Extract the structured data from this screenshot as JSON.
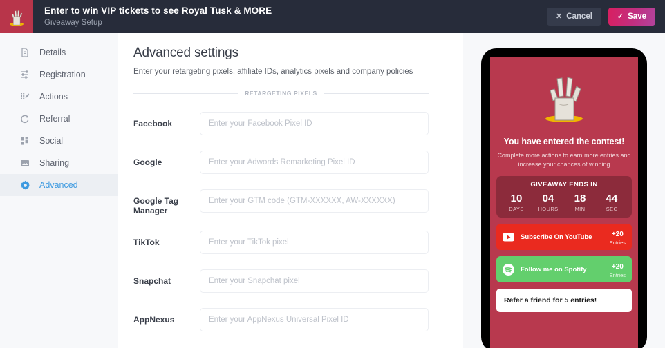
{
  "topbar": {
    "title": "Enter to win VIP tickets to see Royal Tusk & MORE",
    "subtitle": "Giveaway Setup",
    "cancel_label": "Cancel",
    "cancel_icon": "close-x-icon",
    "save_label": "Save",
    "save_icon": "check-icon",
    "logo_icon": "zombie-hand-logo",
    "bg_color": "#272c3a",
    "save_gradient_from": "#d81f60",
    "save_gradient_to": "#b3439c"
  },
  "sidebar": {
    "items": [
      {
        "label": "Details",
        "icon": "document-icon",
        "active": false
      },
      {
        "label": "Registration",
        "icon": "sliders-icon",
        "active": false
      },
      {
        "label": "Actions",
        "icon": "tasks-pen-icon",
        "active": false
      },
      {
        "label": "Referral",
        "icon": "refresh-icon",
        "active": false
      },
      {
        "label": "Social",
        "icon": "grid-icon",
        "active": false
      },
      {
        "label": "Sharing",
        "icon": "image-icon",
        "active": false
      },
      {
        "label": "Advanced",
        "icon": "gear-icon",
        "active": true
      }
    ],
    "active_color": "#3d9ae0"
  },
  "main": {
    "title": "Advanced settings",
    "subtitle": "Enter your retargeting pixels, affiliate IDs, analytics pixels and company policies",
    "section_label": "RETARGETING PIXELS",
    "fields": [
      {
        "label": "Facebook",
        "placeholder": "Enter your Facebook Pixel ID",
        "value": ""
      },
      {
        "label": "Google",
        "placeholder": "Enter your Adwords Remarketing Pixel ID",
        "value": ""
      },
      {
        "label": "Google Tag Manager",
        "placeholder": "Enter your GTM code (GTM-XXXXXX, AW-XXXXXX)",
        "value": ""
      },
      {
        "label": "TikTok",
        "placeholder": "Enter your TikTok pixel",
        "value": ""
      },
      {
        "label": "Snapchat",
        "placeholder": "Enter your Snapchat pixel",
        "value": ""
      },
      {
        "label": "AppNexus",
        "placeholder": "Enter your AppNexus Universal Pixel ID",
        "value": ""
      }
    ]
  },
  "preview": {
    "bg_color": "#b8394e",
    "hero_image": "zombie-hand-illustration",
    "hero_title": "You have entered the contest!",
    "hero_subtitle": "Complete more actions to earn more entries and increase your chances of winning",
    "countdown": {
      "title": "GIVEAWAY ENDS IN",
      "cells": [
        {
          "value": "10",
          "label": "DAYS"
        },
        {
          "value": "04",
          "label": "HOURS"
        },
        {
          "value": "18",
          "label": "MIN"
        },
        {
          "value": "44",
          "label": "SEC"
        }
      ]
    },
    "actions": [
      {
        "label": "Subscribe On YouTube",
        "icon": "youtube-icon",
        "points": "+20",
        "points_label": "Entries",
        "color": "#ea2a1f"
      },
      {
        "label": "Follow me on Spotify",
        "icon": "spotify-icon",
        "points": "+20",
        "points_label": "Entries",
        "color": "#63cf6d"
      }
    ],
    "refer_label": "Refer a friend for 5 entries!"
  }
}
